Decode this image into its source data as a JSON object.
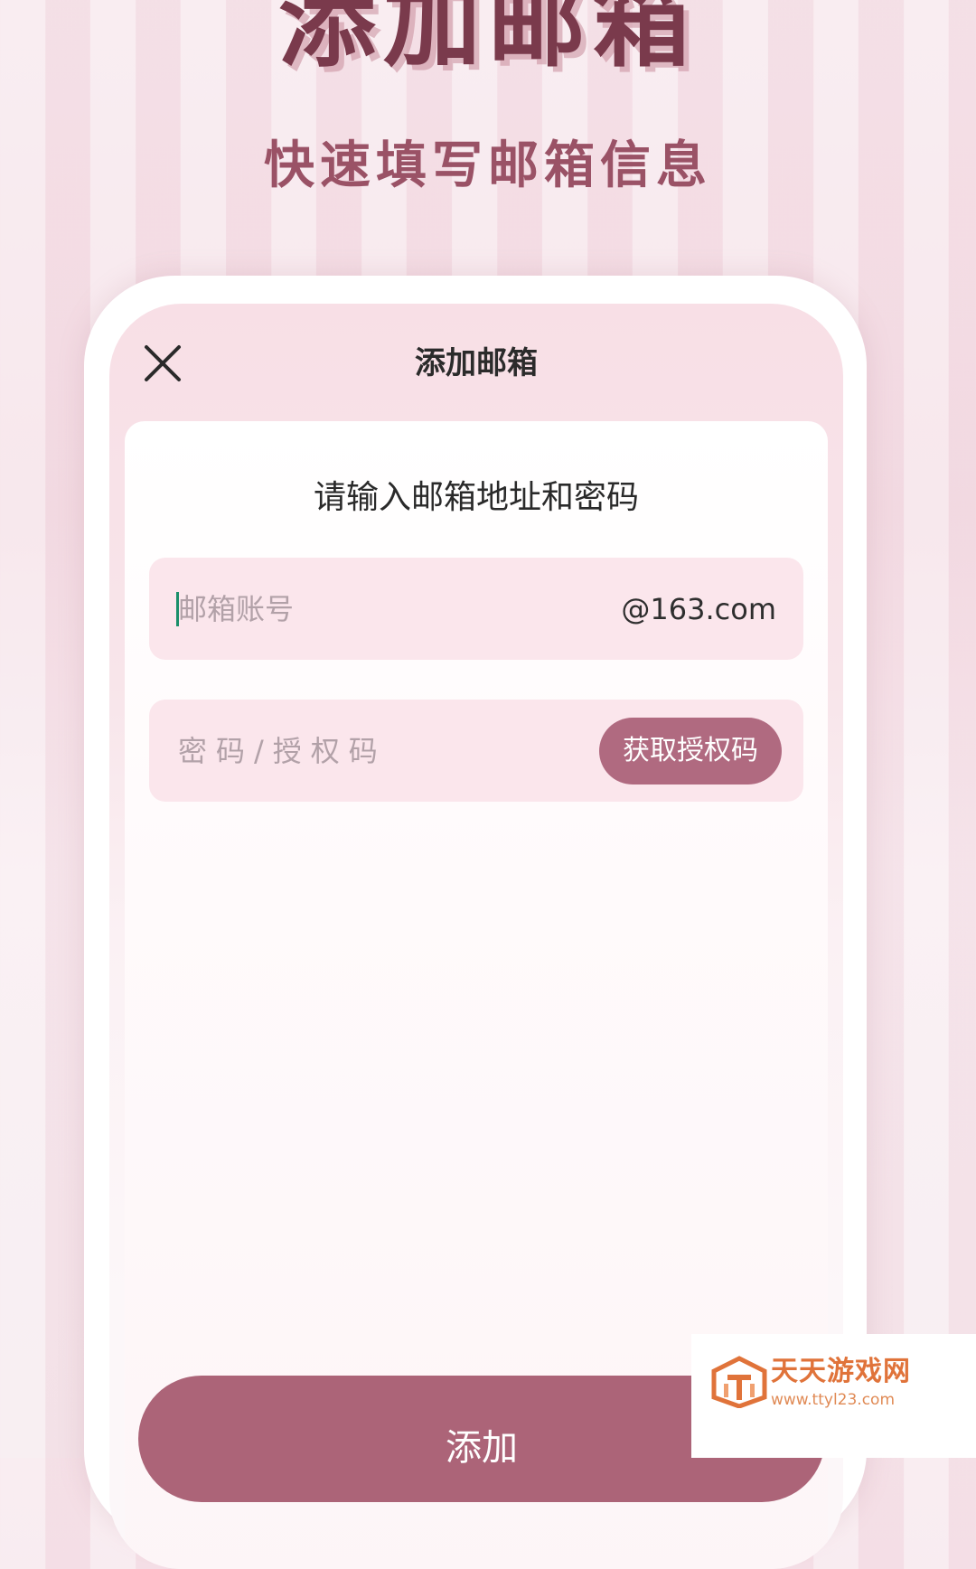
{
  "promo": {
    "title": "添加邮箱",
    "subtitle": "快速填写邮箱信息"
  },
  "navbar": {
    "close_icon": "close-icon",
    "title": "添加邮箱"
  },
  "form": {
    "heading": "请输入邮箱地址和密码",
    "email_placeholder": "邮箱账号",
    "email_value": "",
    "email_suffix": "@163.com",
    "password_placeholder": "密码/授权码",
    "password_value": "",
    "auth_code_button": "获取授权码",
    "submit_button": "添加"
  },
  "watermark": {
    "name": "天天游戏网",
    "url": "www.ttyl23.com"
  },
  "colors": {
    "accent": "#ac6478",
    "title": "#7a3a4c",
    "field_bg": "#fbe6ec",
    "caret": "#1a8f6a"
  }
}
